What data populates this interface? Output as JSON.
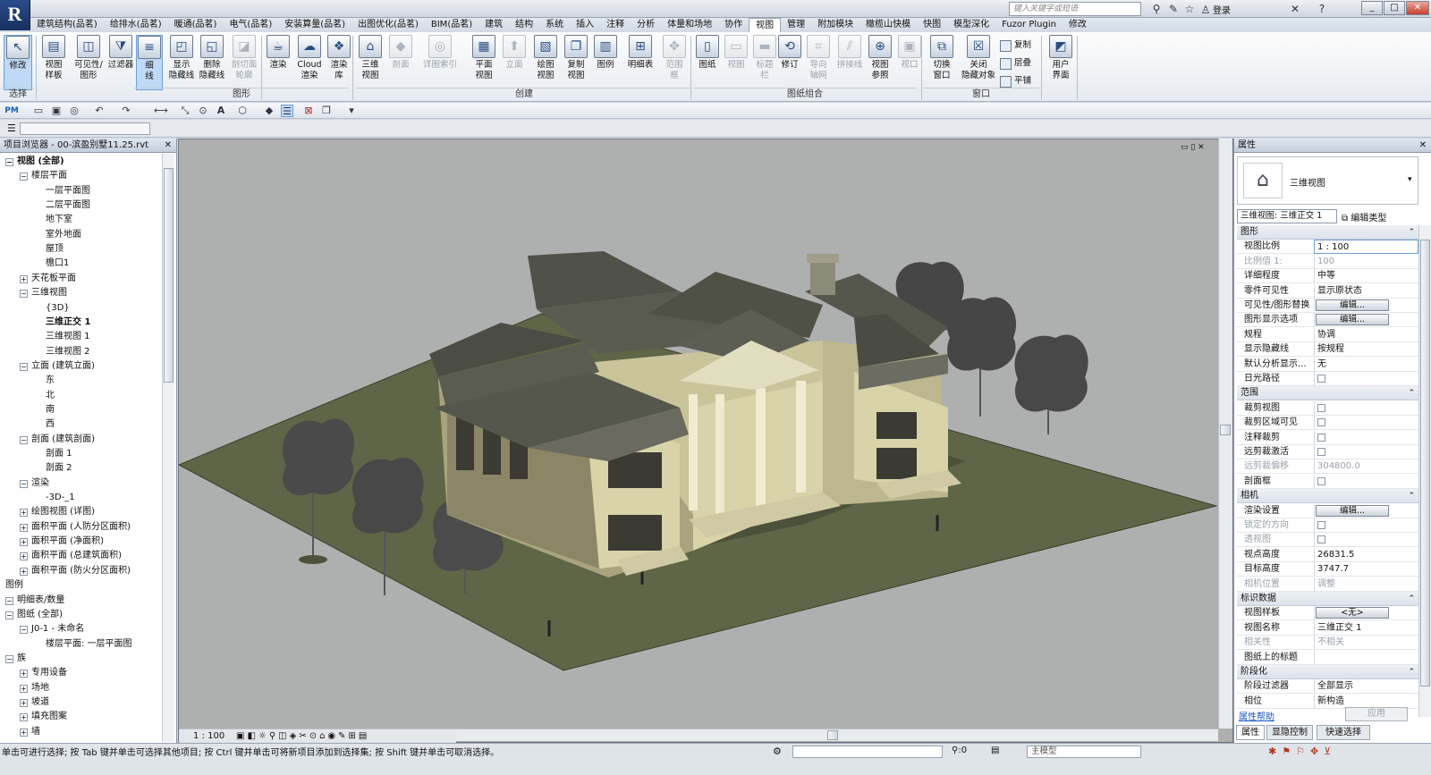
{
  "title_bar": {
    "search_placeholder": "键入关键字或短语",
    "login_label": "登录"
  },
  "ribbon_tabs": [
    {
      "label": "建筑结构(品茗)"
    },
    {
      "label": "给排水(品茗)"
    },
    {
      "label": "暖通(品茗)"
    },
    {
      "label": "电气(品茗)"
    },
    {
      "label": "安装算量(品茗)"
    },
    {
      "label": "出图优化(品茗)"
    },
    {
      "label": "BIM(品茗)"
    },
    {
      "label": "建筑"
    },
    {
      "label": "结构"
    },
    {
      "label": "系统"
    },
    {
      "label": "插入"
    },
    {
      "label": "注释"
    },
    {
      "label": "分析"
    },
    {
      "label": "体量和场地"
    },
    {
      "label": "协作"
    },
    {
      "label": "视图",
      "active": true
    },
    {
      "label": "管理"
    },
    {
      "label": "附加模块"
    },
    {
      "label": "橄榄山快模"
    },
    {
      "label": "快图"
    },
    {
      "label": "模型深化"
    },
    {
      "label": "Fuzor Plugin"
    },
    {
      "label": "修改"
    }
  ],
  "ribbon": {
    "select_label": "选择",
    "panels": [
      {
        "label": "图形"
      },
      {
        "label": "创建"
      },
      {
        "label": "图纸组合"
      },
      {
        "label": "窗口"
      }
    ],
    "buttons": [
      {
        "label": "修改",
        "icon": "cursor-icon"
      },
      {
        "label": "视图\n样板",
        "icon": "template-icon"
      },
      {
        "label": "可见性/\n图形",
        "icon": "visibility-icon"
      },
      {
        "label": "过滤器",
        "icon": "filter-icon"
      },
      {
        "label": "细\n线",
        "icon": "thin-lines-icon"
      },
      {
        "label": "显示\n隐藏线",
        "icon": "show-hidden-icon"
      },
      {
        "label": "删除\n隐藏线",
        "icon": "remove-hidden-icon"
      },
      {
        "label": "剖切面\n轮廓",
        "icon": "cut-profile-icon"
      },
      {
        "label": "渲染",
        "icon": "render-icon"
      },
      {
        "label": "Cloud\n渲染",
        "icon": "cloud-render-icon"
      },
      {
        "label": "渲染\n库",
        "icon": "render-gallery-icon"
      },
      {
        "label": "三维\n视图",
        "icon": "3d-view-icon"
      },
      {
        "label": "剖面",
        "icon": "section-icon"
      },
      {
        "label": "详图索引",
        "icon": "callout-icon"
      },
      {
        "label": "平面\n视图",
        "icon": "plan-view-icon"
      },
      {
        "label": "立面",
        "icon": "elevation-icon"
      },
      {
        "label": "绘图\n视图",
        "icon": "drafting-view-icon"
      },
      {
        "label": "复制\n视图",
        "icon": "duplicate-view-icon"
      },
      {
        "label": "图例",
        "icon": "legend-icon"
      },
      {
        "label": "明细表",
        "icon": "schedule-icon"
      },
      {
        "label": "范围\n框",
        "icon": "scope-box-icon"
      },
      {
        "label": "图纸",
        "icon": "sheet-icon"
      },
      {
        "label": "视图",
        "icon": "view-place-icon"
      },
      {
        "label": "标题\n栏",
        "icon": "title-block-icon"
      },
      {
        "label": "修订",
        "icon": "revision-icon"
      },
      {
        "label": "导向\n轴网",
        "icon": "guide-grid-icon"
      },
      {
        "label": "拼接线",
        "icon": "matchline-icon"
      },
      {
        "label": "视图\n参照",
        "icon": "view-reference-icon"
      },
      {
        "label": "视口",
        "icon": "viewport-icon"
      },
      {
        "label": "切换\n窗口",
        "icon": "switch-window-icon"
      },
      {
        "label": "关闭\n隐藏对象",
        "icon": "close-hidden-icon"
      },
      {
        "label": "用户\n界面",
        "icon": "user-interface-icon"
      }
    ],
    "small_buttons": [
      {
        "label": "复制"
      },
      {
        "label": "层叠"
      },
      {
        "label": "平铺"
      }
    ]
  },
  "browser": {
    "title": "项目浏览器 - 00-滨盈别墅11.25.rvt",
    "items": [
      {
        "label": "视图 (全部)",
        "bold": true
      },
      {
        "label": "楼层平面"
      },
      {
        "label": "一层平面图"
      },
      {
        "label": "二层平面图"
      },
      {
        "label": "地下室"
      },
      {
        "label": "室外地面"
      },
      {
        "label": "屋顶"
      },
      {
        "label": "檐口1"
      },
      {
        "label": "天花板平面"
      },
      {
        "label": "三维视图"
      },
      {
        "label": "{3D}"
      },
      {
        "label": "三维正交 1",
        "bold": true
      },
      {
        "label": "三维视图 1"
      },
      {
        "label": "三维视图 2"
      },
      {
        "label": "立面 (建筑立面)"
      },
      {
        "label": "东"
      },
      {
        "label": "北"
      },
      {
        "label": "南"
      },
      {
        "label": "西"
      },
      {
        "label": "剖面 (建筑剖面)"
      },
      {
        "label": "剖面 1"
      },
      {
        "label": "剖面 2"
      },
      {
        "label": "渲染"
      },
      {
        "label": "-3D-_1"
      },
      {
        "label": "绘图视图 (详图)"
      },
      {
        "label": "面积平面 (人防分区面积)"
      },
      {
        "label": "面积平面 (净面积)"
      },
      {
        "label": "面积平面 (总建筑面积)"
      },
      {
        "label": "面积平面 (防火分区面积)"
      },
      {
        "label": "图例"
      },
      {
        "label": "明细表/数量"
      },
      {
        "label": "图纸 (全部)"
      },
      {
        "label": "J0-1 - 未命名"
      },
      {
        "label": "楼层平面: 一层平面图"
      },
      {
        "label": "族"
      },
      {
        "label": "专用设备"
      },
      {
        "label": "场地"
      },
      {
        "label": "坡道"
      },
      {
        "label": "填充图案"
      },
      {
        "label": "墙"
      }
    ]
  },
  "view_control": {
    "scale": "1 : 100"
  },
  "properties": {
    "title": "属性",
    "type_name": "三维视图",
    "selector": "三维视图: 三维正交 1",
    "edit_type_label": "编辑类型",
    "groups": [
      {
        "label": "图形"
      },
      {
        "label": "范围"
      },
      {
        "label": "相机"
      },
      {
        "label": "标识数据"
      },
      {
        "label": "阶段化"
      }
    ],
    "rows": [
      {
        "k": "视图比例",
        "v": "1 : 100"
      },
      {
        "k": "比例值 1:",
        "v": "100"
      },
      {
        "k": "详细程度",
        "v": "中等"
      },
      {
        "k": "零件可见性",
        "v": "显示原状态"
      },
      {
        "k": "可见性/图形替换",
        "v": "编辑..."
      },
      {
        "k": "图形显示选项",
        "v": "编辑..."
      },
      {
        "k": "规程",
        "v": "协调"
      },
      {
        "k": "显示隐藏线",
        "v": "按规程"
      },
      {
        "k": "默认分析显示...",
        "v": "无"
      },
      {
        "k": "日光路径",
        "v": ""
      },
      {
        "k": "裁剪视图",
        "v": ""
      },
      {
        "k": "裁剪区域可见",
        "v": ""
      },
      {
        "k": "注释裁剪",
        "v": ""
      },
      {
        "k": "远剪裁激活",
        "v": ""
      },
      {
        "k": "远剪裁偏移",
        "v": "304800.0"
      },
      {
        "k": "剖面框",
        "v": ""
      },
      {
        "k": "渲染设置",
        "v": "编辑..."
      },
      {
        "k": "锁定的方向",
        "v": ""
      },
      {
        "k": "透视图",
        "v": ""
      },
      {
        "k": "视点高度",
        "v": "26831.5"
      },
      {
        "k": "目标高度",
        "v": "3747.7"
      },
      {
        "k": "相机位置",
        "v": "调整"
      },
      {
        "k": "视图样板",
        "v": "<无>"
      },
      {
        "k": "视图名称",
        "v": "三维正交 1"
      },
      {
        "k": "相关性",
        "v": "不相关"
      },
      {
        "k": "图纸上的标题",
        "v": ""
      },
      {
        "k": "阶段过滤器",
        "v": "全部显示"
      },
      {
        "k": "相位",
        "v": "新构造"
      }
    ],
    "help_link": "属性帮助",
    "apply_label": "应用",
    "bottom_tabs": [
      {
        "label": "属性"
      },
      {
        "label": "显隐控制"
      },
      {
        "label": "快速选择"
      }
    ]
  },
  "status": {
    "hint": "单击可进行选择; 按 Tab 键并单击可选择其他项目; 按 Ctrl 键并单击可将新项目添加到选择集; 按 Shift 键并单击可取消选择。",
    "counter": ":0",
    "model_label": "主模型"
  },
  "colors": {
    "ground": "#5f6647",
    "roof": "#55574c",
    "wall": "#d8d3a8",
    "wall_shade": "#a9a47e",
    "sky": "#aeb0af"
  }
}
